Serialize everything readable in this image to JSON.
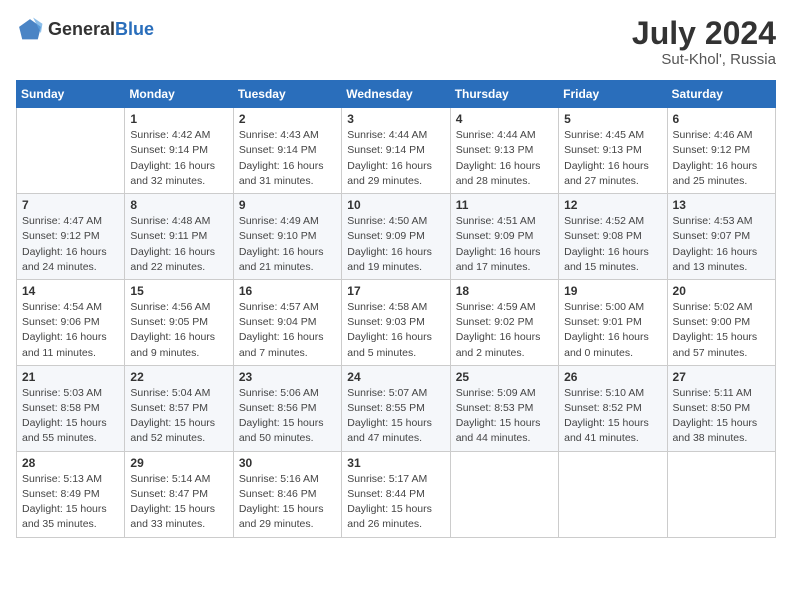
{
  "header": {
    "logo_general": "General",
    "logo_blue": "Blue",
    "title": "July 2024",
    "location": "Sut-Khol', Russia"
  },
  "weekdays": [
    "Sunday",
    "Monday",
    "Tuesday",
    "Wednesday",
    "Thursday",
    "Friday",
    "Saturday"
  ],
  "weeks": [
    [
      {
        "day": "",
        "sunrise": "",
        "sunset": "",
        "daylight": ""
      },
      {
        "day": "1",
        "sunrise": "Sunrise: 4:42 AM",
        "sunset": "Sunset: 9:14 PM",
        "daylight": "Daylight: 16 hours and 32 minutes."
      },
      {
        "day": "2",
        "sunrise": "Sunrise: 4:43 AM",
        "sunset": "Sunset: 9:14 PM",
        "daylight": "Daylight: 16 hours and 31 minutes."
      },
      {
        "day": "3",
        "sunrise": "Sunrise: 4:44 AM",
        "sunset": "Sunset: 9:14 PM",
        "daylight": "Daylight: 16 hours and 29 minutes."
      },
      {
        "day": "4",
        "sunrise": "Sunrise: 4:44 AM",
        "sunset": "Sunset: 9:13 PM",
        "daylight": "Daylight: 16 hours and 28 minutes."
      },
      {
        "day": "5",
        "sunrise": "Sunrise: 4:45 AM",
        "sunset": "Sunset: 9:13 PM",
        "daylight": "Daylight: 16 hours and 27 minutes."
      },
      {
        "day": "6",
        "sunrise": "Sunrise: 4:46 AM",
        "sunset": "Sunset: 9:12 PM",
        "daylight": "Daylight: 16 hours and 25 minutes."
      }
    ],
    [
      {
        "day": "7",
        "sunrise": "Sunrise: 4:47 AM",
        "sunset": "Sunset: 9:12 PM",
        "daylight": "Daylight: 16 hours and 24 minutes."
      },
      {
        "day": "8",
        "sunrise": "Sunrise: 4:48 AM",
        "sunset": "Sunset: 9:11 PM",
        "daylight": "Daylight: 16 hours and 22 minutes."
      },
      {
        "day": "9",
        "sunrise": "Sunrise: 4:49 AM",
        "sunset": "Sunset: 9:10 PM",
        "daylight": "Daylight: 16 hours and 21 minutes."
      },
      {
        "day": "10",
        "sunrise": "Sunrise: 4:50 AM",
        "sunset": "Sunset: 9:09 PM",
        "daylight": "Daylight: 16 hours and 19 minutes."
      },
      {
        "day": "11",
        "sunrise": "Sunrise: 4:51 AM",
        "sunset": "Sunset: 9:09 PM",
        "daylight": "Daylight: 16 hours and 17 minutes."
      },
      {
        "day": "12",
        "sunrise": "Sunrise: 4:52 AM",
        "sunset": "Sunset: 9:08 PM",
        "daylight": "Daylight: 16 hours and 15 minutes."
      },
      {
        "day": "13",
        "sunrise": "Sunrise: 4:53 AM",
        "sunset": "Sunset: 9:07 PM",
        "daylight": "Daylight: 16 hours and 13 minutes."
      }
    ],
    [
      {
        "day": "14",
        "sunrise": "Sunrise: 4:54 AM",
        "sunset": "Sunset: 9:06 PM",
        "daylight": "Daylight: 16 hours and 11 minutes."
      },
      {
        "day": "15",
        "sunrise": "Sunrise: 4:56 AM",
        "sunset": "Sunset: 9:05 PM",
        "daylight": "Daylight: 16 hours and 9 minutes."
      },
      {
        "day": "16",
        "sunrise": "Sunrise: 4:57 AM",
        "sunset": "Sunset: 9:04 PM",
        "daylight": "Daylight: 16 hours and 7 minutes."
      },
      {
        "day": "17",
        "sunrise": "Sunrise: 4:58 AM",
        "sunset": "Sunset: 9:03 PM",
        "daylight": "Daylight: 16 hours and 5 minutes."
      },
      {
        "day": "18",
        "sunrise": "Sunrise: 4:59 AM",
        "sunset": "Sunset: 9:02 PM",
        "daylight": "Daylight: 16 hours and 2 minutes."
      },
      {
        "day": "19",
        "sunrise": "Sunrise: 5:00 AM",
        "sunset": "Sunset: 9:01 PM",
        "daylight": "Daylight: 16 hours and 0 minutes."
      },
      {
        "day": "20",
        "sunrise": "Sunrise: 5:02 AM",
        "sunset": "Sunset: 9:00 PM",
        "daylight": "Daylight: 15 hours and 57 minutes."
      }
    ],
    [
      {
        "day": "21",
        "sunrise": "Sunrise: 5:03 AM",
        "sunset": "Sunset: 8:58 PM",
        "daylight": "Daylight: 15 hours and 55 minutes."
      },
      {
        "day": "22",
        "sunrise": "Sunrise: 5:04 AM",
        "sunset": "Sunset: 8:57 PM",
        "daylight": "Daylight: 15 hours and 52 minutes."
      },
      {
        "day": "23",
        "sunrise": "Sunrise: 5:06 AM",
        "sunset": "Sunset: 8:56 PM",
        "daylight": "Daylight: 15 hours and 50 minutes."
      },
      {
        "day": "24",
        "sunrise": "Sunrise: 5:07 AM",
        "sunset": "Sunset: 8:55 PM",
        "daylight": "Daylight: 15 hours and 47 minutes."
      },
      {
        "day": "25",
        "sunrise": "Sunrise: 5:09 AM",
        "sunset": "Sunset: 8:53 PM",
        "daylight": "Daylight: 15 hours and 44 minutes."
      },
      {
        "day": "26",
        "sunrise": "Sunrise: 5:10 AM",
        "sunset": "Sunset: 8:52 PM",
        "daylight": "Daylight: 15 hours and 41 minutes."
      },
      {
        "day": "27",
        "sunrise": "Sunrise: 5:11 AM",
        "sunset": "Sunset: 8:50 PM",
        "daylight": "Daylight: 15 hours and 38 minutes."
      }
    ],
    [
      {
        "day": "28",
        "sunrise": "Sunrise: 5:13 AM",
        "sunset": "Sunset: 8:49 PM",
        "daylight": "Daylight: 15 hours and 35 minutes."
      },
      {
        "day": "29",
        "sunrise": "Sunrise: 5:14 AM",
        "sunset": "Sunset: 8:47 PM",
        "daylight": "Daylight: 15 hours and 33 minutes."
      },
      {
        "day": "30",
        "sunrise": "Sunrise: 5:16 AM",
        "sunset": "Sunset: 8:46 PM",
        "daylight": "Daylight: 15 hours and 29 minutes."
      },
      {
        "day": "31",
        "sunrise": "Sunrise: 5:17 AM",
        "sunset": "Sunset: 8:44 PM",
        "daylight": "Daylight: 15 hours and 26 minutes."
      },
      {
        "day": "",
        "sunrise": "",
        "sunset": "",
        "daylight": ""
      },
      {
        "day": "",
        "sunrise": "",
        "sunset": "",
        "daylight": ""
      },
      {
        "day": "",
        "sunrise": "",
        "sunset": "",
        "daylight": ""
      }
    ]
  ]
}
